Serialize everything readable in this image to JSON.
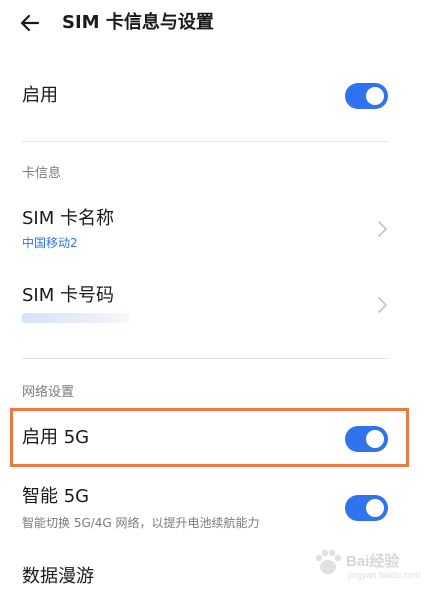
{
  "header": {
    "title": "SIM 卡信息与设置"
  },
  "enable_row": {
    "label": "启用",
    "toggle_on": true
  },
  "card_info": {
    "section_label": "卡信息",
    "name_row": {
      "title": "SIM 卡名称",
      "value": "中国移动2"
    },
    "number_row": {
      "title": "SIM 卡号码"
    }
  },
  "network": {
    "section_label": "网络设置",
    "enable_5g": {
      "label": "启用 5G",
      "toggle_on": true
    },
    "smart_5g": {
      "label": "智能 5G",
      "description": "智能切换 5G/4G 网络，以提升电池续航能力",
      "toggle_on": true
    },
    "roaming": {
      "label": "数据漫游"
    }
  },
  "watermark": {
    "brand": "Bai经验",
    "sub": "jingyan.baidu.com"
  },
  "colors": {
    "accent": "#2f73ee",
    "link": "#2f73ee",
    "highlight": "#ee7a43",
    "divider": "#e4e4e4",
    "secondary_text": "#7a7a7a"
  }
}
